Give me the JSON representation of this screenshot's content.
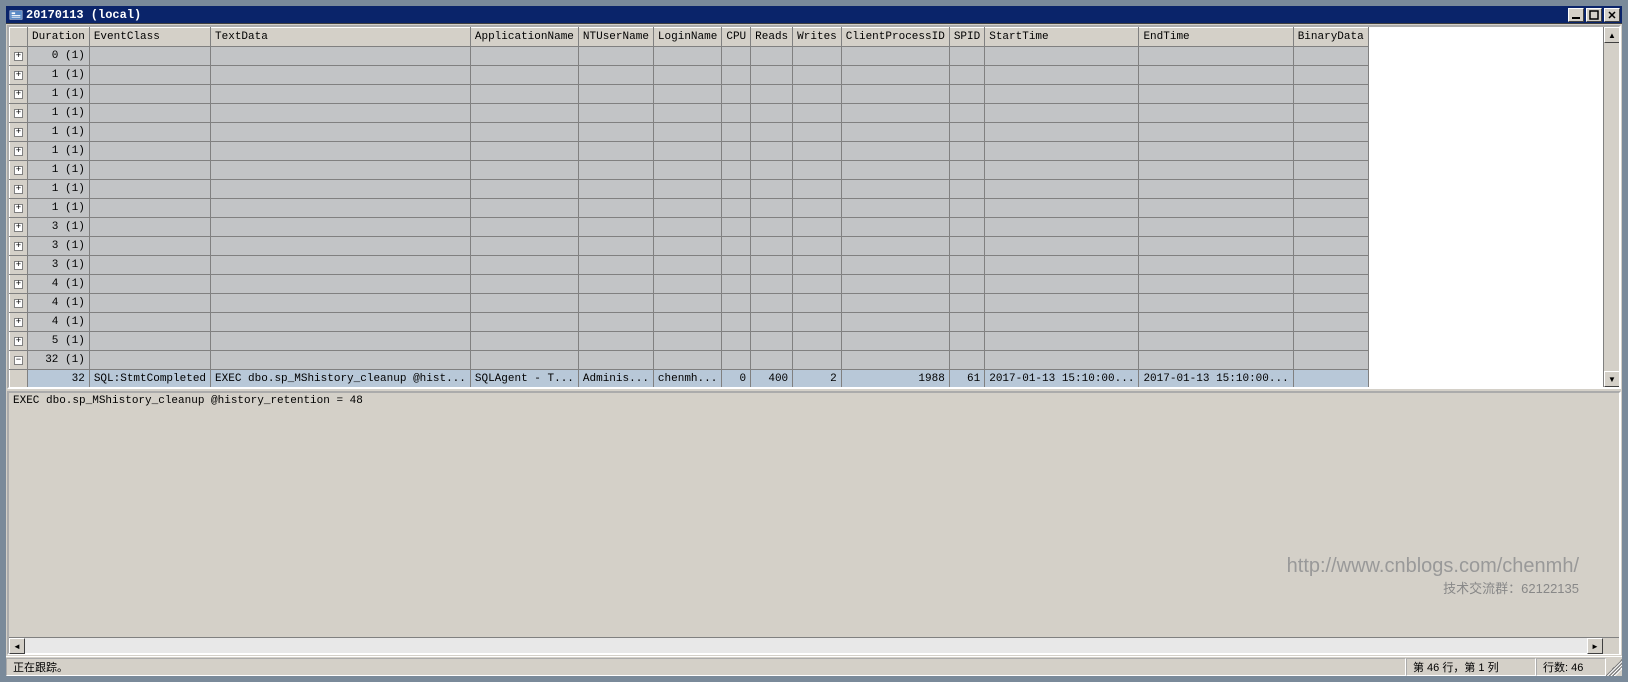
{
  "titlebar": {
    "title": "20170113 (local)"
  },
  "columns": [
    "Duration",
    "EventClass",
    "TextData",
    "ApplicationName",
    "NTUserName",
    "LoginName",
    "CPU",
    "Reads",
    "Writes",
    "ClientProcessID",
    "SPID",
    "StartTime",
    "EndTime",
    "BinaryData"
  ],
  "rows": [
    {
      "exp": "+",
      "dur": "0 (1)"
    },
    {
      "exp": "+",
      "dur": "1 (1)"
    },
    {
      "exp": "+",
      "dur": "1 (1)"
    },
    {
      "exp": "+",
      "dur": "1 (1)"
    },
    {
      "exp": "+",
      "dur": "1 (1)"
    },
    {
      "exp": "+",
      "dur": "1 (1)"
    },
    {
      "exp": "+",
      "dur": "1 (1)"
    },
    {
      "exp": "+",
      "dur": "1 (1)"
    },
    {
      "exp": "+",
      "dur": "1 (1)"
    },
    {
      "exp": "+",
      "dur": "3 (1)"
    },
    {
      "exp": "+",
      "dur": "3 (1)"
    },
    {
      "exp": "+",
      "dur": "3 (1)"
    },
    {
      "exp": "+",
      "dur": "4 (1)"
    },
    {
      "exp": "+",
      "dur": "4 (1)"
    },
    {
      "exp": "+",
      "dur": "4 (1)"
    },
    {
      "exp": "+",
      "dur": "5 (1)"
    },
    {
      "exp": "-",
      "dur": "32 (1)"
    },
    {
      "exp": "",
      "dur": "32",
      "evt": "SQL:StmtCompleted",
      "txt": "EXEC dbo.sp_MShistory_cleanup @hist...",
      "app": "SQLAgent - T...",
      "ntu": "Adminis...",
      "log": "chenmh...",
      "cpu": "0",
      "rea": "400",
      "wri": "2",
      "cpi": "1988",
      "spi": "61",
      "sta": "2017-01-13 15:10:00...",
      "end": "2017-01-13 15:10:00...",
      "bin": "",
      "sel": true
    }
  ],
  "detail_text": "EXEC dbo.sp_MShistory_cleanup @history_retention = 48",
  "watermark": {
    "url": "http://www.cnblogs.com/chenmh/",
    "qq": "技术交流群：62122135"
  },
  "status": {
    "left": "正在跟踪。",
    "pos": "第 46 行，第 1 列",
    "count": "行数: 46"
  }
}
